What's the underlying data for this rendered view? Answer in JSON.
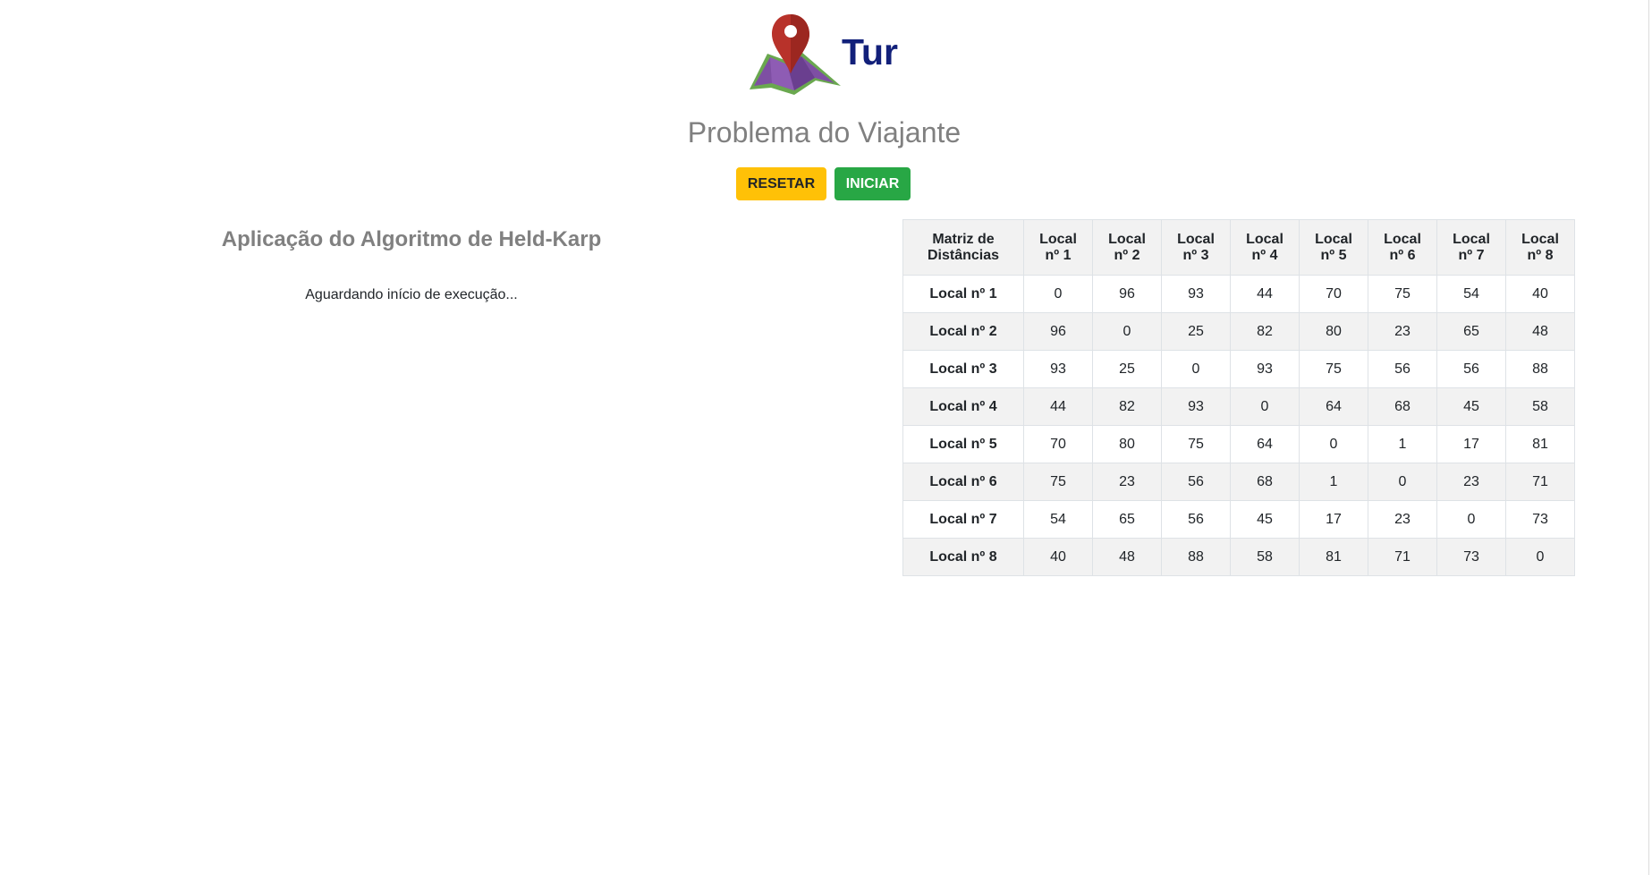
{
  "header": {
    "brand_title": "Tur",
    "subtitle": "Problema do Viajante",
    "logo_icon": "map-pin-icon"
  },
  "actions": {
    "reset_label": "RESETAR",
    "start_label": "INICIAR"
  },
  "algorithm": {
    "title": "Aplicação do Algoritmo de Held-Karp",
    "status": "Aguardando início de execução..."
  },
  "matrix": {
    "corner_line1": "Matriz de",
    "corner_line2": "Distâncias",
    "columns": [
      {
        "line1": "Local",
        "line2": "nº 1"
      },
      {
        "line1": "Local",
        "line2": "nº 2"
      },
      {
        "line1": "Local",
        "line2": "nº 3"
      },
      {
        "line1": "Local",
        "line2": "nº 4"
      },
      {
        "line1": "Local",
        "line2": "nº 5"
      },
      {
        "line1": "Local",
        "line2": "nº 6"
      },
      {
        "line1": "Local",
        "line2": "nº 7"
      },
      {
        "line1": "Local",
        "line2": "nº 8"
      }
    ],
    "rows": [
      {
        "label": "Local nº 1",
        "values": [
          "0",
          "96",
          "93",
          "44",
          "70",
          "75",
          "54",
          "40"
        ]
      },
      {
        "label": "Local nº 2",
        "values": [
          "96",
          "0",
          "25",
          "82",
          "80",
          "23",
          "65",
          "48"
        ]
      },
      {
        "label": "Local nº 3",
        "values": [
          "93",
          "25",
          "0",
          "93",
          "75",
          "56",
          "56",
          "88"
        ]
      },
      {
        "label": "Local nº 4",
        "values": [
          "44",
          "82",
          "93",
          "0",
          "64",
          "68",
          "45",
          "58"
        ]
      },
      {
        "label": "Local nº 5",
        "values": [
          "70",
          "80",
          "75",
          "64",
          "0",
          "1",
          "17",
          "81"
        ]
      },
      {
        "label": "Local nº 6",
        "values": [
          "75",
          "23",
          "56",
          "68",
          "1",
          "0",
          "23",
          "71"
        ]
      },
      {
        "label": "Local nº 7",
        "values": [
          "54",
          "65",
          "56",
          "45",
          "17",
          "23",
          "0",
          "73"
        ]
      },
      {
        "label": "Local nº 8",
        "values": [
          "40",
          "48",
          "88",
          "58",
          "81",
          "71",
          "73",
          "0"
        ]
      }
    ]
  },
  "colors": {
    "brand": "#12207a",
    "reset_button": "#ffc107",
    "start_button": "#28a745",
    "pin": "#b8322a",
    "map": "#7e4fa3",
    "map_border": "#6aa84f"
  }
}
